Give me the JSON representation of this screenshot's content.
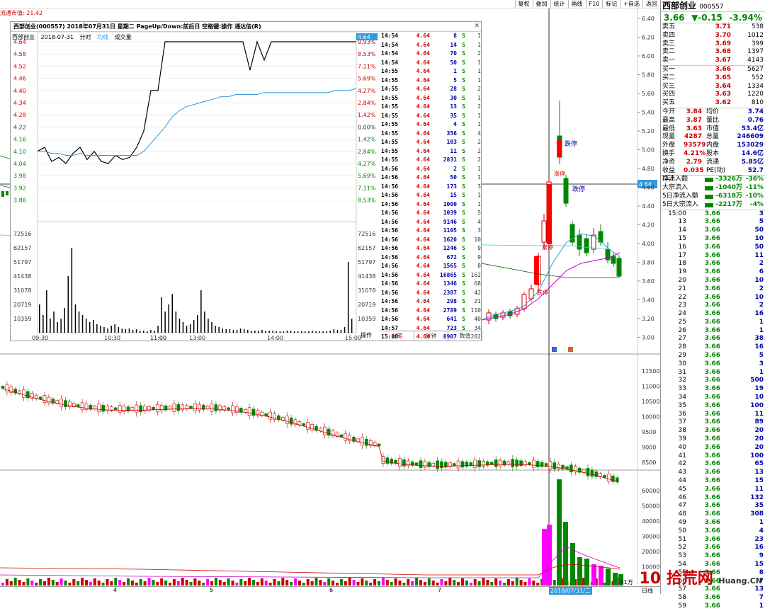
{
  "topbar": {
    "buttons": [
      "复权",
      "叠加",
      "统计",
      "画线",
      "F10",
      "标记",
      "+自选",
      "返回"
    ]
  },
  "float_label": "流通市值: 21.42",
  "popup": {
    "title": "西部创业(000557)  2018年07月31日 星期二  PageUp/Down:前后日 空格键:操作 通达信(R)",
    "subtitle_name": "西部创业",
    "subtitle_date": "2018-07-31",
    "subtitle_tab1": "分时",
    "subtitle_tab2": "均线",
    "subtitle_tab3": "成交量",
    "price_ticks": [
      "4.64",
      "4.58",
      "4.52",
      "4.46",
      "4.40",
      "4.34",
      "4.28",
      "4.22",
      "4.16",
      "4.10",
      "4.04",
      "3.98",
      "3.92",
      "3.86"
    ],
    "pct_ticks": [
      "9.93%",
      "8.53%",
      "7.11%",
      "5.69%",
      "4.27%",
      "2.84%",
      "1.42%",
      "0.00%",
      "1.42%",
      "2.84%",
      "4.27%",
      "5.69%",
      "7.11%",
      "8.53%"
    ],
    "vol_ticks": [
      "72516",
      "62157",
      "51797",
      "41438",
      "31078",
      "20719",
      "10359"
    ],
    "time_ticks": [
      "09:30",
      "10:30",
      "11:00",
      "13:00",
      "14:00",
      "15:00"
    ],
    "op_label": "操作",
    "last_price_tag": "4.64",
    "tabs": [
      "分笔",
      "分钟",
      "数值"
    ],
    "ticks": [
      {
        "t": "14:54",
        "p": "4.64",
        "v": "8",
        "s": "S",
        "n": "1"
      },
      {
        "t": "14:54",
        "p": "4.64",
        "v": "14",
        "s": "S",
        "n": "1"
      },
      {
        "t": "14:54",
        "p": "4.64",
        "v": "70",
        "s": "S",
        "n": "2"
      },
      {
        "t": "14:54",
        "p": "4.64",
        "v": "50",
        "s": "S",
        "n": "1"
      },
      {
        "t": "14:55",
        "p": "4.64",
        "v": "1",
        "s": "S",
        "n": "1"
      },
      {
        "t": "14:55",
        "p": "4.64",
        "v": "5",
        "s": "S",
        "n": "1"
      },
      {
        "t": "14:55",
        "p": "4.64",
        "v": "28",
        "s": "S",
        "n": "2"
      },
      {
        "t": "14:55",
        "p": "4.64",
        "v": "30",
        "s": "S",
        "n": "1"
      },
      {
        "t": "14:55",
        "p": "4.64",
        "v": "13",
        "s": "S",
        "n": "2"
      },
      {
        "t": "14:55",
        "p": "4.64",
        "v": "35",
        "s": "S",
        "n": "1"
      },
      {
        "t": "14:55",
        "p": "4.64",
        "v": "4",
        "s": "S",
        "n": "1"
      },
      {
        "t": "14:55",
        "p": "4.64",
        "v": "356",
        "s": "S",
        "n": "4"
      },
      {
        "t": "14:55",
        "p": "4.64",
        "v": "103",
        "s": "S",
        "n": "2"
      },
      {
        "t": "14:55",
        "p": "4.64",
        "v": "11",
        "s": "S",
        "n": "2"
      },
      {
        "t": "14:55",
        "p": "4.64",
        "v": "2831",
        "s": "S",
        "n": "2"
      },
      {
        "t": "14:56",
        "p": "4.64",
        "v": "2",
        "s": "S",
        "n": "1"
      },
      {
        "t": "14:56",
        "p": "4.64",
        "v": "50",
        "s": "S",
        "n": "1"
      },
      {
        "t": "14:56",
        "p": "4.64",
        "v": "173",
        "s": "S",
        "n": "3"
      },
      {
        "t": "14:56",
        "p": "4.64",
        "v": "15",
        "s": "S",
        "n": "1"
      },
      {
        "t": "14:56",
        "p": "4.64",
        "v": "1000",
        "s": "S",
        "n": "1"
      },
      {
        "t": "14:56",
        "p": "4.64",
        "v": "1039",
        "s": "S",
        "n": "5"
      },
      {
        "t": "14:56",
        "p": "4.64",
        "v": "9146",
        "s": "S",
        "n": "4"
      },
      {
        "t": "14:56",
        "p": "4.64",
        "v": "1105",
        "s": "S",
        "n": "3"
      },
      {
        "t": "14:56",
        "p": "4.64",
        "v": "1620",
        "s": "S",
        "n": "10"
      },
      {
        "t": "14:56",
        "p": "4.64",
        "v": "1246",
        "s": "S",
        "n": "9"
      },
      {
        "t": "14:56",
        "p": "4.64",
        "v": "672",
        "s": "S",
        "n": "9"
      },
      {
        "t": "14:56",
        "p": "4.64",
        "v": "1565",
        "s": "S",
        "n": "8"
      },
      {
        "t": "14:56",
        "p": "4.64",
        "v": "16865",
        "s": "S",
        "n": "162"
      },
      {
        "t": "14:56",
        "p": "4.64",
        "v": "1346",
        "s": "S",
        "n": "68"
      },
      {
        "t": "14:56",
        "p": "4.64",
        "v": "2387",
        "s": "S",
        "n": "42"
      },
      {
        "t": "14:56",
        "p": "4.64",
        "v": "298",
        "s": "S",
        "n": "21"
      },
      {
        "t": "14:56",
        "p": "4.64",
        "v": "2789",
        "s": "S",
        "n": "110"
      },
      {
        "t": "14:56",
        "p": "4.64",
        "v": "641",
        "s": "S",
        "n": "40"
      },
      {
        "t": "14:57",
        "p": "4.64",
        "v": "723",
        "s": "S",
        "n": "34"
      },
      {
        "t": "15:00",
        "p": "4.64",
        "v": "8907",
        "s": "",
        "n": "282"
      }
    ]
  },
  "kline": {
    "price_ticks": [
      "6.40",
      "6.20",
      "6.00",
      "5.80",
      "5.60",
      "5.40",
      "5.20",
      "5.00",
      "4.80",
      "4.60",
      "4.40",
      "4.20",
      "4.00",
      "3.80",
      "3.60",
      "3.40",
      "3.20",
      "3.00"
    ],
    "crosshair_price": "4.64",
    "labels": {
      "limit_up": "跌停",
      "limit_down": "跌停",
      "label_a": "涨停",
      "label_b": "涨停",
      "label_c": "跌停"
    },
    "index_ticks": [
      "11500",
      "11000",
      "10500",
      "10000",
      "9500",
      "9000",
      "8500"
    ],
    "vol_ticks": [
      "60000",
      "50000",
      "40000",
      "30000",
      "20000",
      "10000"
    ],
    "x_ticks": [
      "4",
      "5",
      "6",
      "7"
    ],
    "date_label": "2018/07/31/二",
    "unit_label": "X1万",
    "period_label": "日线"
  },
  "right_panel": {
    "name": "西部创业",
    "code": "000557",
    "price": "3.66",
    "change": "▼-0.15",
    "change_pct": "-3.94%",
    "asks": [
      {
        "k": "卖五",
        "p": "3.71",
        "v": "538"
      },
      {
        "k": "卖四",
        "p": "3.70",
        "v": "1012"
      },
      {
        "k": "卖三",
        "p": "3.69",
        "v": "399"
      },
      {
        "k": "卖二",
        "p": "3.68",
        "v": "1397"
      },
      {
        "k": "卖一",
        "p": "3.67",
        "v": "4143"
      }
    ],
    "bids": [
      {
        "k": "买一",
        "p": "3.66",
        "v": "5627"
      },
      {
        "k": "买二",
        "p": "3.65",
        "v": "552"
      },
      {
        "k": "买三",
        "p": "3.64",
        "v": "1334"
      },
      {
        "k": "买四",
        "p": "3.63",
        "v": "1220"
      },
      {
        "k": "买五",
        "p": "3.62",
        "v": "810"
      }
    ],
    "details": [
      {
        "k": "今开",
        "v": "3.84",
        "k2": "均价",
        "v2": "3.74"
      },
      {
        "k": "最高",
        "v": "3.87",
        "k2": "量比",
        "v2": "0.76"
      },
      {
        "k": "最低",
        "v": "3.63",
        "k2": "市值",
        "v2": "53.4亿"
      },
      {
        "k": "现量",
        "v": "4287",
        "k2": "总量",
        "v2": "246609"
      },
      {
        "k": "外盘",
        "v": "93579",
        "k2": "内盘",
        "v2": "153029"
      },
      {
        "k": "换手",
        "v": "4.21%",
        "k2": "股本",
        "v2": "14.6亿"
      },
      {
        "k": "净资",
        "v": "2.79",
        "k2": "流通",
        "v2": "5.85亿"
      },
      {
        "k": "收益(二)",
        "v": "0.035",
        "k2": "PE(动)",
        "v2": "52.7"
      }
    ],
    "flows": [
      {
        "k": "净流入额",
        "v": "-3326万",
        "pc": "-36%"
      },
      {
        "k": "大宗流入",
        "v": "-1040万",
        "pc": "-11%"
      },
      {
        "k": "5日净流入额",
        "v": "-6318万",
        "pc": "-10%"
      },
      {
        "k": "5日大宗流入",
        "v": "-2217万",
        "pc": "-4%"
      }
    ],
    "trades_header": "15:00",
    "trades": [
      {
        "t": "15:00",
        "p": "3.66",
        "v": "3"
      },
      {
        "t": "13",
        "p": "3.66",
        "v": "5"
      },
      {
        "t": "14",
        "p": "3.66",
        "v": "50"
      },
      {
        "t": "15",
        "p": "3.66",
        "v": "10"
      },
      {
        "t": "16",
        "p": "3.66",
        "v": "50"
      },
      {
        "t": "17",
        "p": "3.66",
        "v": "11"
      },
      {
        "t": "18",
        "p": "3.66",
        "v": "2"
      },
      {
        "t": "19",
        "p": "3.66",
        "v": "6"
      },
      {
        "t": "20",
        "p": "3.66",
        "v": "10"
      },
      {
        "t": "21",
        "p": "3.66",
        "v": "2"
      },
      {
        "t": "22",
        "p": "3.66",
        "v": "10"
      },
      {
        "t": "23",
        "p": "3.66",
        "v": "2"
      },
      {
        "t": "24",
        "p": "3.66",
        "v": "16"
      },
      {
        "t": "25",
        "p": "3.66",
        "v": "1"
      },
      {
        "t": "26",
        "p": "3.66",
        "v": "1"
      },
      {
        "t": "27",
        "p": "3.66",
        "v": "38"
      },
      {
        "t": "28",
        "p": "3.66",
        "v": "16"
      },
      {
        "t": "29",
        "p": "3.66",
        "v": "5"
      },
      {
        "t": "30",
        "p": "3.66",
        "v": "3"
      },
      {
        "t": "31",
        "p": "3.66",
        "v": "1"
      },
      {
        "t": "32",
        "p": "3.66",
        "v": "500"
      },
      {
        "t": "33",
        "p": "3.66",
        "v": "19"
      },
      {
        "t": "34",
        "p": "3.66",
        "v": "10"
      },
      {
        "t": "35",
        "p": "3.66",
        "v": "100"
      },
      {
        "t": "36",
        "p": "3.66",
        "v": "11"
      },
      {
        "t": "37",
        "p": "3.66",
        "v": "89"
      },
      {
        "t": "38",
        "p": "3.66",
        "v": "20"
      },
      {
        "t": "39",
        "p": "3.66",
        "v": "20"
      },
      {
        "t": "40",
        "p": "3.66",
        "v": "20"
      },
      {
        "t": "41",
        "p": "3.66",
        "v": "100"
      },
      {
        "t": "42",
        "p": "3.66",
        "v": "65"
      },
      {
        "t": "43",
        "p": "3.66",
        "v": "13"
      },
      {
        "t": "44",
        "p": "3.66",
        "v": "15"
      },
      {
        "t": "45",
        "p": "3.66",
        "v": "11"
      },
      {
        "t": "46",
        "p": "3.66",
        "v": "132"
      },
      {
        "t": "47",
        "p": "3.66",
        "v": "35"
      },
      {
        "t": "48",
        "p": "3.66",
        "v": "308"
      },
      {
        "t": "49",
        "p": "3.66",
        "v": "1"
      },
      {
        "t": "50",
        "p": "3.66",
        "v": "4"
      },
      {
        "t": "51",
        "p": "3.66",
        "v": "23"
      },
      {
        "t": "52",
        "p": "3.66",
        "v": "16"
      },
      {
        "t": "53",
        "p": "3.66",
        "v": "9"
      },
      {
        "t": "54",
        "p": "3.66",
        "v": "15"
      },
      {
        "t": "55",
        "p": "3.66",
        "v": "8"
      },
      {
        "t": "56",
        "p": "3.66",
        "v": "7"
      },
      {
        "t": "57",
        "p": "3.66",
        "v": "13"
      },
      {
        "t": "58",
        "p": "3.66",
        "v": "7"
      },
      {
        "t": "59",
        "p": "3.66",
        "v": "1"
      }
    ]
  },
  "watermark": {
    "big": "10",
    "text": "拾荒网",
    "url": "Huang.CN"
  },
  "colors": {
    "up": "#cc0000",
    "down": "#008800",
    "avg_line": "#3399dd",
    "magenta": "#ff00ff"
  }
}
